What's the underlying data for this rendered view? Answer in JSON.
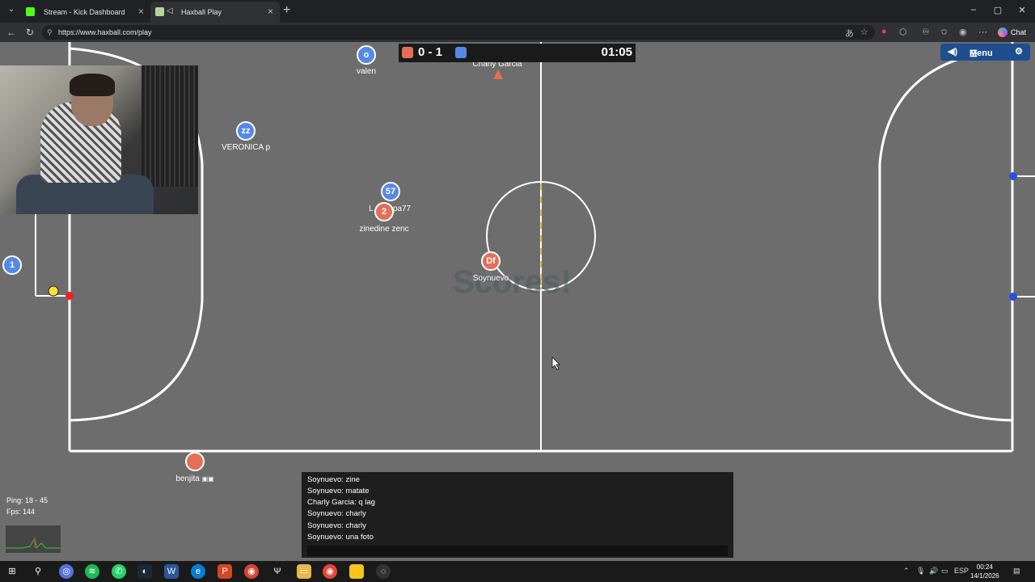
{
  "browser": {
    "tabs": [
      {
        "title": "Stream - Kick Dashboard",
        "color": "#53fc18"
      },
      {
        "title": "Haxball Play",
        "color": "#b5d5a0"
      }
    ],
    "url": "https://www.haxball.com/play",
    "chat_label": "Chat"
  },
  "game": {
    "score": "0 - 1",
    "time": "01:05",
    "menu_label": "Menu",
    "watermark": "Scores!",
    "colors": {
      "red": "#e56e56",
      "blue": "#5689e5",
      "pitch": "#6d6d6d",
      "lines": "#ffffff"
    },
    "players": [
      {
        "name": "valen",
        "avatar": "o",
        "team": "blue"
      },
      {
        "name": "VERONICA p",
        "avatar": "zz",
        "team": "blue"
      },
      {
        "name": "L",
        "avatar": "57",
        "team": "blue"
      },
      {
        "name": "pa77",
        "avatar": "",
        "team": "blue"
      },
      {
        "name": "zinedine zenc",
        "avatar": "2",
        "team": "red"
      },
      {
        "name": "Soynuevo",
        "avatar": "Df",
        "team": "red"
      },
      {
        "name": "Charly Garcia",
        "avatar": "",
        "team": "red"
      },
      {
        "name": "benjita",
        "avatar": "",
        "team": "red"
      },
      {
        "name": "",
        "avatar": "1",
        "team": "blue"
      }
    ]
  },
  "stats": {
    "ping": "Ping: 18 - 45",
    "fps": "Fps: 144"
  },
  "chat": {
    "messages": [
      "Soynuevo: zine",
      "Soynuevo: matate",
      "Charly Garcia: q lag",
      "Soynuevo: charly",
      "Soynuevo: charly",
      "Soynuevo: una foto"
    ],
    "input_value": ""
  },
  "taskbar": {
    "lang": "ESP",
    "time": "00:24",
    "date": "14/1/2026"
  }
}
